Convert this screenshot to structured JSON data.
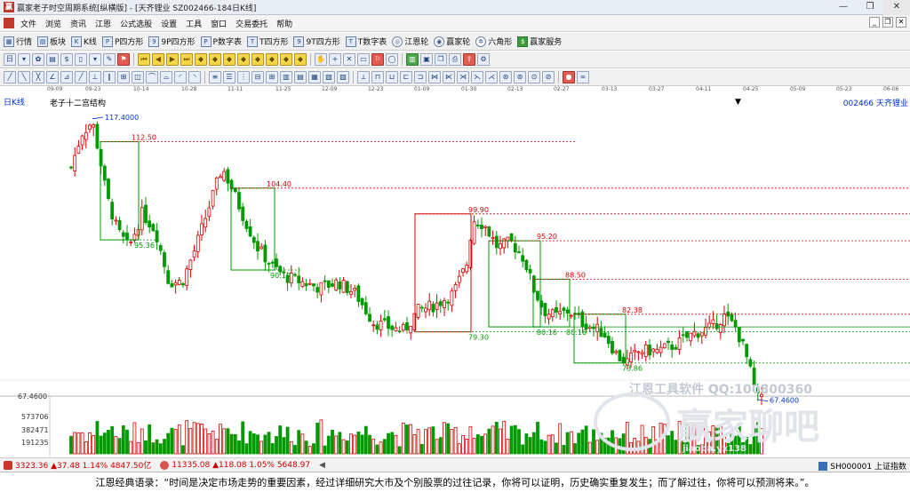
{
  "window": {
    "title": "赢家老子时空周期系统[纵横版] - [天齐锂业  SZ002466-184日K线]",
    "minimize": "—",
    "restore": "❐",
    "close": "✕"
  },
  "menu": [
    "文件",
    "浏览",
    "资讯",
    "江恩",
    "公式选股",
    "设置",
    "工具",
    "窗口",
    "交易委托",
    "帮助"
  ],
  "mdi": {
    "min": "_",
    "restore": "❐",
    "close": "✕"
  },
  "toolbar1": [
    {
      "label": "行情",
      "icon": "grid-icon"
    },
    {
      "label": "板块",
      "icon": "blocks-icon"
    },
    {
      "label": "K线",
      "icon": "kline-icon"
    },
    {
      "label": "P四方形",
      "icon": "p-square-icon"
    },
    {
      "label": "9P四方形",
      "icon": "9p-square-icon"
    },
    {
      "label": "P数字表",
      "icon": "p-table-icon"
    },
    {
      "label": "T四方形",
      "icon": "t-square-icon"
    },
    {
      "label": "9T四方形",
      "icon": "9t-square-icon"
    },
    {
      "label": "T数字表",
      "icon": "t-table-icon"
    },
    {
      "label": "江恩轮",
      "icon": "gann-wheel-icon"
    },
    {
      "label": "赢家轮",
      "icon": "winner-wheel-icon"
    },
    {
      "label": "六角形",
      "icon": "hexagon-icon"
    },
    {
      "label": "赢家服务",
      "icon": "dollar-icon"
    }
  ],
  "dates": [
    "09-09",
    "09-23",
    "10-14",
    "10-28",
    "11-11",
    "11-25",
    "12-09",
    "12-23",
    "01-09",
    "01-30",
    "02-13",
    "02-27",
    "03-13",
    "03-27",
    "04-11",
    "04-25",
    "05-09",
    "05-23",
    "06-06"
  ],
  "chart": {
    "period_label": "日K线",
    "structure_label": "老子十二宫结构",
    "stock_label": "002466  天齐锂业",
    "high_label": "117.4000",
    "low_label": "67.4600",
    "axis_price": "67.4600",
    "vol_ticks": [
      "573706",
      "382471",
      "191235"
    ],
    "levels": [
      {
        "label": "112.50",
        "color": "#c00000"
      },
      {
        "label": "104.40",
        "color": "#c00000"
      },
      {
        "label": "99.90",
        "color": "#c00000"
      },
      {
        "label": "95.20",
        "color": "#c00000"
      },
      {
        "label": "88.50",
        "color": "#c00000"
      },
      {
        "label": "82.38",
        "color": "#c00000"
      },
      {
        "label": "95.36",
        "color": "#007700"
      },
      {
        "label": "90.10",
        "color": "#007700"
      },
      {
        "label": "79.30",
        "color": "#007700"
      },
      {
        "label": "80.16",
        "color": "#007700"
      },
      {
        "label": "80.16",
        "color": "#007700"
      },
      {
        "label": "73.86",
        "color": "#007700"
      }
    ],
    "watermark_tool": "江恩工具软件   QQ:100800360",
    "watermark_brand": "赢家聊吧",
    "watermark_sub": "jiaoba.yx138"
  },
  "status": {
    "index1": "3323.36 ▲37.48 1.14% 4847.50亿",
    "index2": "11335.08 ▲118.08 1.05% 5648.97",
    "right": "SH000001 上证指数"
  },
  "quote": "江恩经典语录：“时间是决定市场走势的重要因素，经过详细研究大市及个别股票的过往记录，你将可以证明，历史确实重复发生；而了解过往，你将可以预测将来。”。",
  "colors": {
    "up": "#d40000",
    "down": "#009900",
    "red_box": "#d40000",
    "green_box": "#009900"
  }
}
